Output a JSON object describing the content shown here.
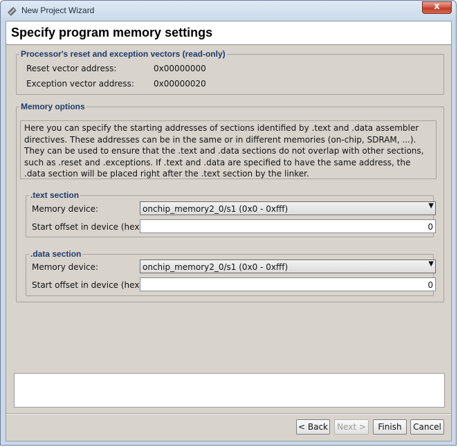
{
  "window": {
    "title": "New Project Wizard",
    "close_label": "x"
  },
  "page": {
    "title": "Specify program memory settings"
  },
  "vectors": {
    "legend": "Processor's reset and exception vectors (read-only)",
    "reset_label": "Reset vector address:",
    "reset_value": "0x00000000",
    "exception_label": "Exception vector address:",
    "exception_value": "0x00000020"
  },
  "memory_options": {
    "legend": "Memory options",
    "description": "Here you can specify the starting addresses of sections identified by .text and .data assembler directives. These addresses can be in the same or in different memories (on-chip, SDRAM, ...). They can be used to ensure that the .text and .data sections do not overlap with other sections, such as .reset and .exceptions. If .text and .data are specified to have the same address, the .data section will be placed right after the .text section by the linker.",
    "text_section": {
      "legend": ".text section",
      "device_label": "Memory device:",
      "device_value": "onchip_memory2_0/s1 (0x0 - 0xfff)",
      "offset_label": "Start offset in device (hex):",
      "offset_value": "0"
    },
    "data_section": {
      "legend": ".data section",
      "device_label": "Memory device:",
      "device_value": "onchip_memory2_0/s1 (0x0 - 0xfff)",
      "offset_label": "Start offset in device (hex):",
      "offset_value": "0"
    }
  },
  "buttons": {
    "back": "< Back",
    "next": "Next >",
    "finish": "Finish",
    "cancel": "Cancel"
  }
}
